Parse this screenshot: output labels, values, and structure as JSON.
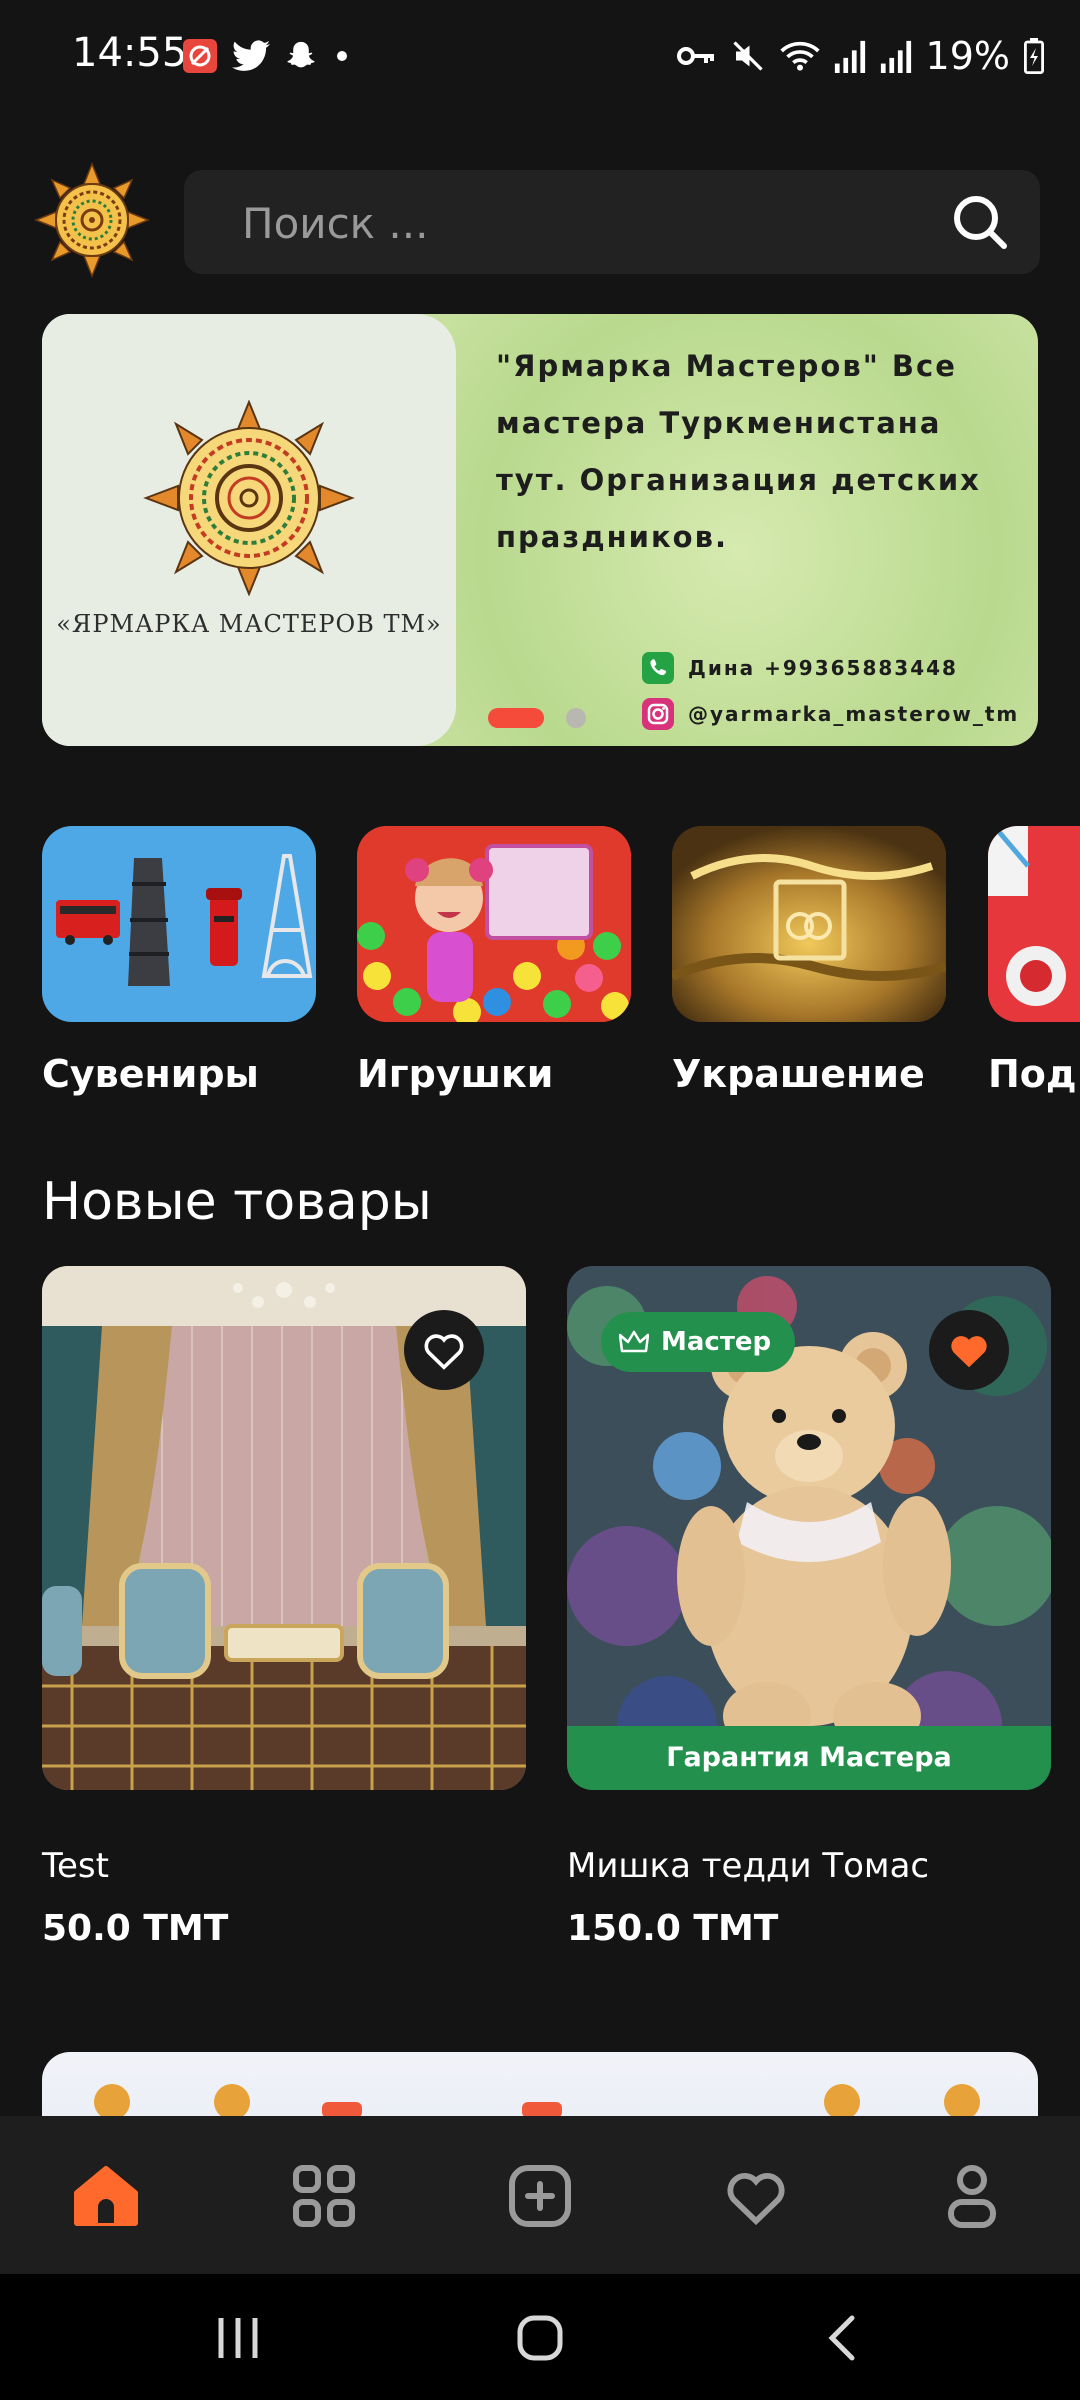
{
  "status_bar": {
    "time": "14:55",
    "battery": "19%"
  },
  "search": {
    "placeholder": "Поиск ..."
  },
  "banner": {
    "logo_text": "«ЯРМАРКА МАСТЕРОВ ТМ»",
    "headline": "\"Ярмарка Мастеров\" Все мастера Туркменистана тут. Организация детских праздников.",
    "phone_contact": "Дина +99365883448",
    "instagram": "@yarmarka_masterow_tm",
    "colors": {
      "indicator_active": "#f44b3b"
    }
  },
  "categories": [
    {
      "label": "Сувениры"
    },
    {
      "label": "Игрушки"
    },
    {
      "label": "Украшение"
    },
    {
      "label": "Под"
    }
  ],
  "new_products": {
    "title": "Новые товары",
    "items": [
      {
        "name": "Test",
        "price": "50.0 ТМТ",
        "favorite": false
      },
      {
        "name": "Мишка тедди Томас",
        "price": "150.0 ТМТ",
        "favorite": true,
        "badge": "Мастер",
        "guarantee": "Гарантия Мастера"
      }
    ]
  },
  "bottom_nav": {
    "items": [
      {
        "icon": "home-icon",
        "active": true
      },
      {
        "icon": "grid-icon",
        "active": false
      },
      {
        "icon": "add-square-icon",
        "active": false
      },
      {
        "icon": "heart-icon",
        "active": false
      },
      {
        "icon": "profile-icon",
        "active": false
      }
    ],
    "colors": {
      "active": "#ff6a2c",
      "inactive": "#9a9a9a"
    }
  },
  "colors": {
    "background": "#141414",
    "accent_green": "#23914d",
    "accent_orange": "#ff6a2c"
  }
}
